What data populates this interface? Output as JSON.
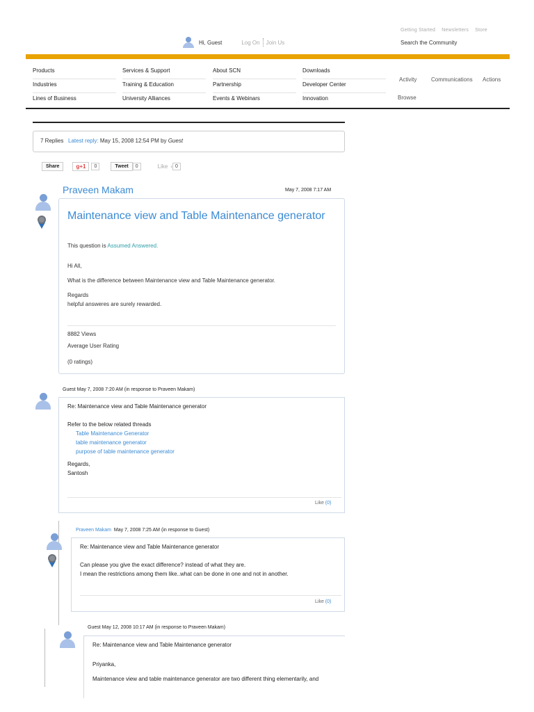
{
  "header": {
    "top_links": [
      "Getting Started",
      "Newsletters",
      "Store"
    ],
    "search_label": "Search the Community",
    "greeting": "Hi, Guest",
    "login": "Log On",
    "join": "Join Us",
    "accent_color": "#e8a300"
  },
  "nav": {
    "col1": [
      "Products",
      "Industries",
      "Lines of Business"
    ],
    "col2": [
      "Services & Support",
      "Training & Education",
      "University Alliances"
    ],
    "col3": [
      "About SCN",
      "Partnership",
      "Events & Webinars"
    ],
    "col4": [
      "Downloads",
      "Developer Center",
      "Innovation"
    ],
    "right_tabs": [
      "Activity",
      "Communications",
      "Actions"
    ],
    "browse": "Browse"
  },
  "thread": {
    "replies_count": "7 Replies",
    "latest_label": "Latest reply:",
    "latest_date": "May 15, 2008 12:54 PM by",
    "latest_by": "Guest",
    "share": "Share",
    "gplus": "+1",
    "gplus_count": "0",
    "tweet": "Tweet",
    "tweet_count": "0",
    "like_label": "Like",
    "like_count": "0"
  },
  "question": {
    "author": "Praveen Makam",
    "date": "May 7, 2008 7:17 AM",
    "title": "Maintenance view and Table Maintenance generator",
    "status_prefix": "This question is",
    "status_link": "Assumed Answered.",
    "body": [
      "Hi All,",
      "What is the difference between Maintenance view and Table Maintenance generator.",
      "Regards",
      "helpful answeres are surely rewarded."
    ],
    "views": "8882 Views",
    "rating_label": "Average User Rating",
    "ratings": "(0 ratings)"
  },
  "replies": [
    {
      "author": "Guest",
      "date": "May 7, 2008 7:20 AM",
      "in_response": "(in response to Praveen Makam)",
      "subject": "Re: Maintenance view and Table Maintenance generator",
      "intro": "Refer to the below related threads",
      "links": [
        "Table Maintenance Generator",
        "table maintenance generator",
        "purpose of table maintenance generator"
      ],
      "sign1": "Regards,",
      "sign2": "Santosh",
      "like": "Like",
      "like_count": "(0)"
    },
    {
      "author": "Praveen Makam",
      "date": "May 7, 2008 7:25 AM",
      "in_response": "(in response to Guest)",
      "subject": "Re: Maintenance view and Table Maintenance generator",
      "line1": "Can please you give the exact difference? instead of what they are.",
      "line2": "I mean the restrictions among them like..what can be done in one and not in another.",
      "like": "Like",
      "like_count": "(0)"
    },
    {
      "author": "Guest",
      "date": "May 12, 2008 10:17 AM",
      "in_response": "(in response to Praveen Makam)",
      "subject": "Re: Maintenance view and Table Maintenance generator",
      "line1": "Priyanka,",
      "line2": "Maintenance view and table maintenance generator are two different thing elementarily, and"
    }
  ]
}
